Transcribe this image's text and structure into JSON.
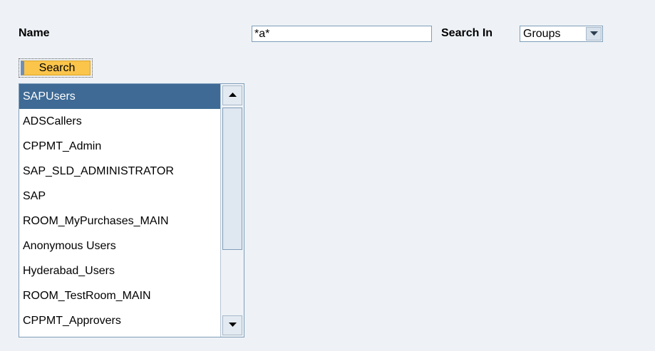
{
  "form": {
    "name_label": "Name",
    "name_value": "*a*",
    "search_in_label": "Search In",
    "search_in_selected": "Groups",
    "search_button_label": "Search"
  },
  "results": {
    "selected_index": 0,
    "items": [
      "SAPUsers",
      "ADSCallers",
      "CPPMT_Admin",
      "SAP_SLD_ADMINISTRATOR",
      "SAP",
      "ROOM_MyPurchases_MAIN",
      "Anonymous Users",
      "Hyderabad_Users",
      "ROOM_TestRoom_MAIN",
      "CPPMT_Approvers"
    ]
  },
  "icons": {
    "dropdown": "chevron-down-icon",
    "scroll_up": "triangle-up-icon",
    "scroll_down": "triangle-down-icon"
  },
  "colors": {
    "page_background": "#eef2f6",
    "button_fill": "#fbc54c",
    "selection": "#3e6a95"
  }
}
